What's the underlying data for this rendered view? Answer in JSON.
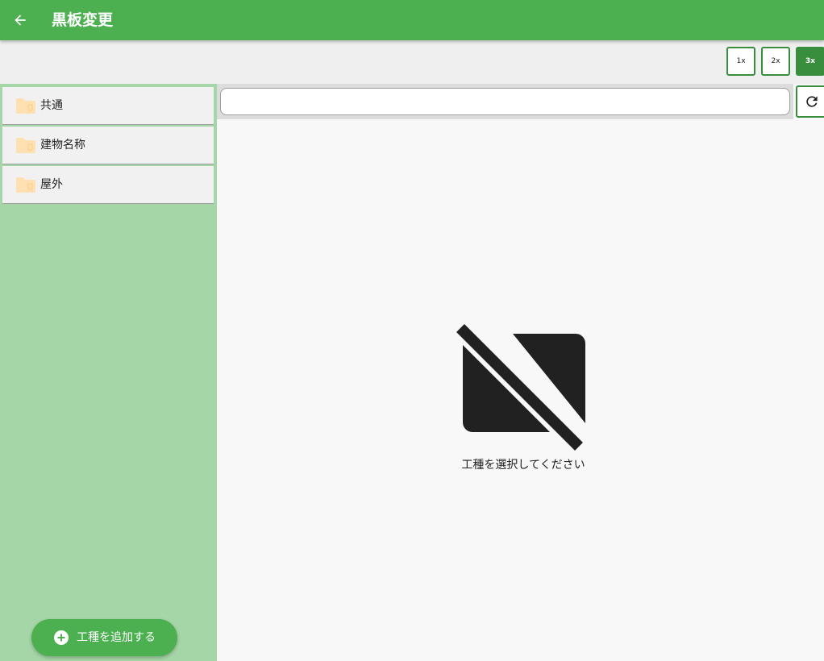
{
  "appbar": {
    "title": "黒板変更",
    "back_icon": "arrow-left-icon",
    "color": "#4caf50"
  },
  "zoom": {
    "options": [
      "1x",
      "2x",
      "3x"
    ],
    "selected": "3x",
    "accent": "#388e3c"
  },
  "sidebar": {
    "background": "#a5d6a7",
    "items": [
      {
        "label": "共通",
        "icon": "folder-icon"
      },
      {
        "label": "建物名称",
        "icon": "folder-icon"
      },
      {
        "label": "屋外",
        "icon": "folder-icon"
      }
    ],
    "add_button": {
      "label": "工種を追加する",
      "icon": "plus-circle-icon"
    }
  },
  "search": {
    "value": "",
    "placeholder": "",
    "refresh_icon": "refresh-icon"
  },
  "empty_state": {
    "icon": "folder-off-icon",
    "message": "工種を選択してください"
  }
}
